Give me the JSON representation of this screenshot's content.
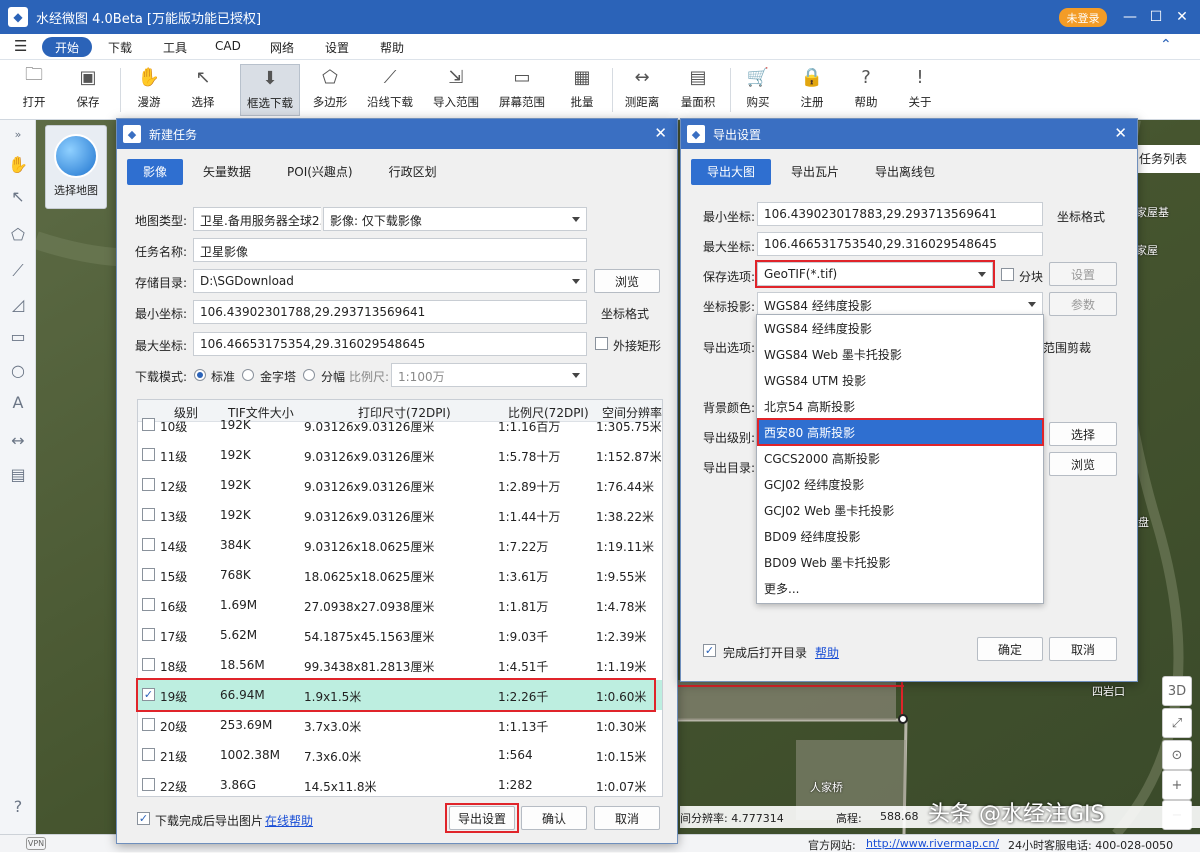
{
  "app": {
    "title": "水经微图 4.0Beta [万能版功能已授权]",
    "login_label": "未登录",
    "min": "—",
    "max": "☐",
    "close": "✕"
  },
  "menu": {
    "items": [
      "开始",
      "下载",
      "工具",
      "CAD",
      "网络",
      "设置",
      "帮助"
    ]
  },
  "toolbar": {
    "items": [
      "打开",
      "保存",
      "漫游",
      "选择",
      "框选下载",
      "多边形",
      "沿线下载",
      "导入范围",
      "屏幕范围",
      "批量",
      "测距离",
      "量面积",
      "购买",
      "注册",
      "帮助",
      "关于"
    ]
  },
  "map": {
    "select_map_label": "选择地图",
    "task_list": "任务列表",
    "labels": [
      "家屋基",
      "家屋",
      "四岩口",
      "人家桥",
      "盘"
    ],
    "status_left": "间分辨率: 4.777314",
    "status_elev": "高程:",
    "status_elev_value": "588.68",
    "watermark": "头条 @水经注GIS",
    "controls": [
      "3D",
      "⤢",
      "⊙",
      "+",
      "−"
    ]
  },
  "status": {
    "site_label": "官方网站:",
    "site_url": "http://www.rivermap.cn/",
    "hotline": "24小时客服电话: 400-028-0050"
  },
  "new_task": {
    "title": "新建任务",
    "tabs": [
      "影像",
      "矢量数据",
      "POI(兴趣点)",
      "行政区划"
    ],
    "map_type_label": "地图类型:",
    "map_type_value": "卫星.备用服务器全球2.0",
    "image_option": "影像: 仅下载影像",
    "task_name_label": "任务名称:",
    "task_name_value": "卫星影像",
    "save_dir_label": "存储目录:",
    "save_dir_value": "D:\\SGDownload",
    "browse": "浏览",
    "min_coord_label": "最小坐标:",
    "min_coord_value": "106.43902301788,29.293713569641",
    "coord_format": "坐标格式",
    "max_coord_label": "最大坐标:",
    "max_coord_value": "106.46653175354,29.316029548645",
    "outer_rect": "外接矩形",
    "mode_label": "下载模式:",
    "mode_standard": "标准",
    "mode_pyramid": "金字塔",
    "mode_tile": "分幅",
    "scale_label": "比例尺:",
    "scale_value": "1:100万",
    "columns": [
      "级别",
      "TIF文件大小",
      "打印尺寸(72DPI)",
      "比例尺(72DPI)",
      "空间分辨率"
    ],
    "rows": [
      {
        "level": "10级",
        "size": "192K",
        "print": "9.03126x9.03126厘米",
        "scale": "1:1.16百万",
        "res": "1:305.75米",
        "checked": false
      },
      {
        "level": "11级",
        "size": "192K",
        "print": "9.03126x9.03126厘米",
        "scale": "1:5.78十万",
        "res": "1:152.87米",
        "checked": false
      },
      {
        "level": "12级",
        "size": "192K",
        "print": "9.03126x9.03126厘米",
        "scale": "1:2.89十万",
        "res": "1:76.44米",
        "checked": false
      },
      {
        "level": "13级",
        "size": "192K",
        "print": "9.03126x9.03126厘米",
        "scale": "1:1.44十万",
        "res": "1:38.22米",
        "checked": false
      },
      {
        "level": "14级",
        "size": "384K",
        "print": "9.03126x18.0625厘米",
        "scale": "1:7.22万",
        "res": "1:19.11米",
        "checked": false
      },
      {
        "level": "15级",
        "size": "768K",
        "print": "18.0625x18.0625厘米",
        "scale": "1:3.61万",
        "res": "1:9.55米",
        "checked": false
      },
      {
        "level": "16级",
        "size": "1.69M",
        "print": "27.0938x27.0938厘米",
        "scale": "1:1.81万",
        "res": "1:4.78米",
        "checked": false
      },
      {
        "level": "17级",
        "size": "5.62M",
        "print": "54.1875x45.1563厘米",
        "scale": "1:9.03千",
        "res": "1:2.39米",
        "checked": false
      },
      {
        "level": "18级",
        "size": "18.56M",
        "print": "99.3438x81.2813厘米",
        "scale": "1:4.51千",
        "res": "1:1.19米",
        "checked": false
      },
      {
        "level": "19级",
        "size": "66.94M",
        "print": "1.9x1.5米",
        "scale": "1:2.26千",
        "res": "1:0.60米",
        "checked": true
      },
      {
        "level": "20级",
        "size": "253.69M",
        "print": "3.7x3.0米",
        "scale": "1:1.13千",
        "res": "1:0.30米",
        "checked": false
      },
      {
        "level": "21级",
        "size": "1002.38M",
        "print": "7.3x6.0米",
        "scale": "1:564",
        "res": "1:0.15米",
        "checked": false
      },
      {
        "level": "22级",
        "size": "3.86G",
        "print": "14.5x11.8米",
        "scale": "1:282",
        "res": "1:0.07米",
        "checked": false
      }
    ],
    "export_after": "下载完成后导出图片",
    "online_help": "在线帮助",
    "export_settings": "导出设置",
    "confirm": "确认",
    "cancel": "取消"
  },
  "export": {
    "title": "导出设置",
    "tabs": [
      "导出大图",
      "导出瓦片",
      "导出离线包"
    ],
    "min_coord_label": "最小坐标:",
    "min_coord_value": "106.439023017883,29.293713569641",
    "coord_format": "坐标格式",
    "max_coord_label": "最大坐标:",
    "max_coord_value": "106.466531753540,29.316029548645",
    "save_opt_label": "保存选项:",
    "save_opt_value": "GeoTIF(*.tif)",
    "split_label": "分块",
    "settings_btn": "设置",
    "proj_label": "坐标投影:",
    "proj_value": "WGS84 经纬度投影",
    "params_btn": "参数",
    "export_opt_label": "导出选项:",
    "range_clip": "范围剪裁",
    "bg_color_label": "背景颜色:",
    "level_label": "导出级别:",
    "select_btn": "选择",
    "dir_label": "导出目录:",
    "browse_btn": "浏览",
    "proj_options": [
      "WGS84 经纬度投影",
      "WGS84 Web 墨卡托投影",
      "WGS84 UTM 投影",
      "北京54 高斯投影",
      "西安80 高斯投影",
      "CGCS2000 高斯投影",
      "GCJ02 经纬度投影",
      "GCJ02 Web 墨卡托投影",
      "BD09 经纬度投影",
      "BD09 Web 墨卡托投影",
      "更多..."
    ],
    "proj_highlight": "西安80 高斯投影",
    "open_after": "完成后打开目录",
    "help": "帮助",
    "ok": "确定",
    "cancel": "取消"
  },
  "colors": {
    "accent": "#2b63b8",
    "highlight_row": "#bdeee0",
    "red_box": "#e0242a"
  }
}
